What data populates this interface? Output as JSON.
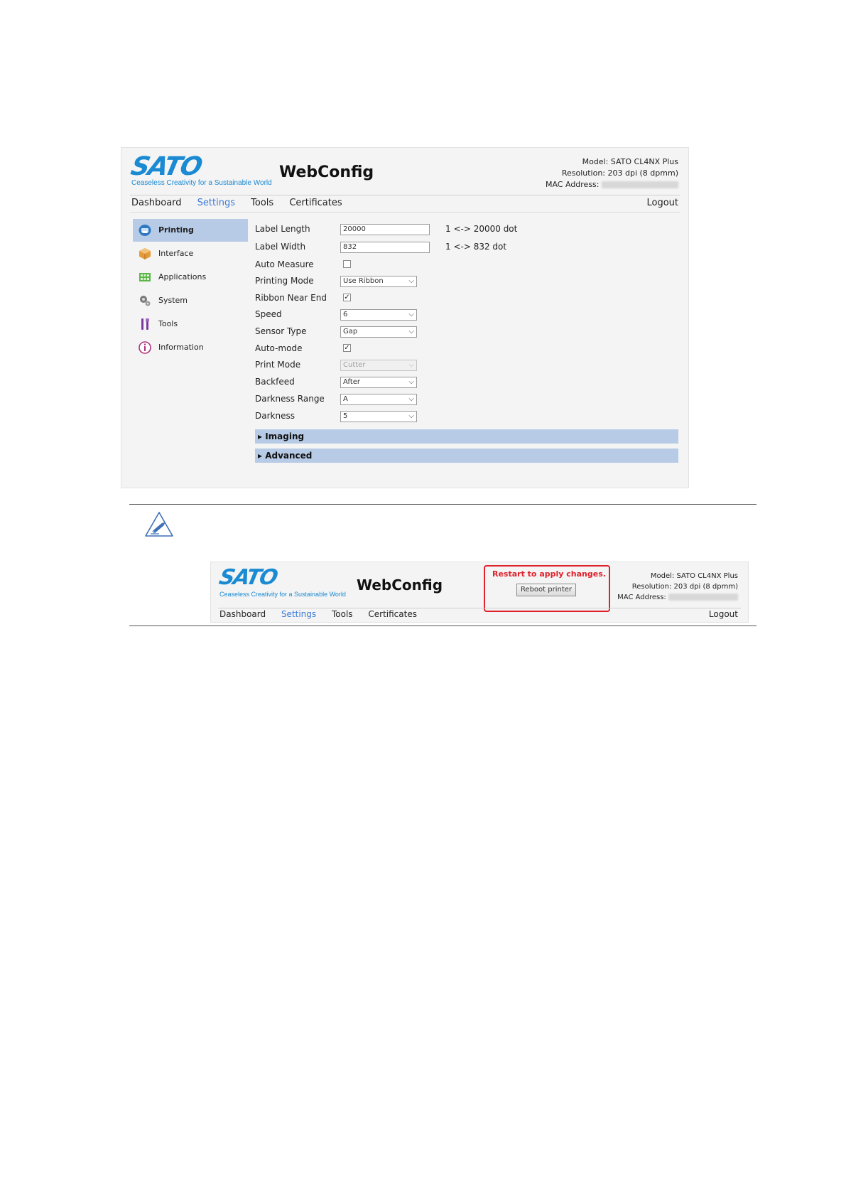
{
  "app": {
    "brand": "SATO",
    "tagline": "Ceaseless Creativity for a Sustainable World",
    "title": "WebConfig",
    "brand_color": "#1a8ad3"
  },
  "header_info": {
    "model": "Model: SATO CL4NX Plus",
    "resolution": "Resolution: 203 dpi (8 dpmm)",
    "mac_label": "MAC Address:"
  },
  "nav": {
    "items": [
      "Dashboard",
      "Settings",
      "Tools",
      "Certificates"
    ],
    "active": "Settings",
    "logout": "Logout"
  },
  "sidebar": {
    "items": [
      {
        "label": "Printing",
        "icon": "printer-icon",
        "active": true
      },
      {
        "label": "Interface",
        "icon": "interface-box-icon",
        "active": false
      },
      {
        "label": "Applications",
        "icon": "applications-grid-icon",
        "active": false
      },
      {
        "label": "System",
        "icon": "gears-icon",
        "active": false
      },
      {
        "label": "Tools",
        "icon": "tools-icon",
        "active": false
      },
      {
        "label": "Information",
        "icon": "info-icon",
        "active": false
      }
    ]
  },
  "form": {
    "label_length": {
      "label": "Label Length",
      "value": "20000",
      "range": "1 <-> 20000 dot"
    },
    "label_width": {
      "label": "Label Width",
      "value": "832",
      "range": "1 <-> 832 dot"
    },
    "auto_measure": {
      "label": "Auto Measure",
      "checked": false
    },
    "printing_mode": {
      "label": "Printing Mode",
      "value": "Use Ribbon"
    },
    "ribbon_near_end": {
      "label": "Ribbon Near End",
      "checked": true
    },
    "speed": {
      "label": "Speed",
      "value": "6"
    },
    "sensor_type": {
      "label": "Sensor Type",
      "value": "Gap"
    },
    "auto_mode": {
      "label": "Auto-mode",
      "checked": true
    },
    "print_mode": {
      "label": "Print Mode",
      "value": "Cutter",
      "disabled": true
    },
    "backfeed": {
      "label": "Backfeed",
      "value": "After"
    },
    "darkness_range": {
      "label": "Darkness Range",
      "value": "A"
    },
    "darkness": {
      "label": "Darkness",
      "value": "5"
    }
  },
  "sections": {
    "imaging": "▸ Imaging",
    "advanced": "▸ Advanced"
  },
  "note": {
    "icon": "pencil-note-icon",
    "restart_text": "Restart to apply changes.",
    "reboot_button": "Reboot printer",
    "alert_color": "#e0202a"
  },
  "glyphs": {
    "check": "✓",
    "chevron": "⌵"
  }
}
